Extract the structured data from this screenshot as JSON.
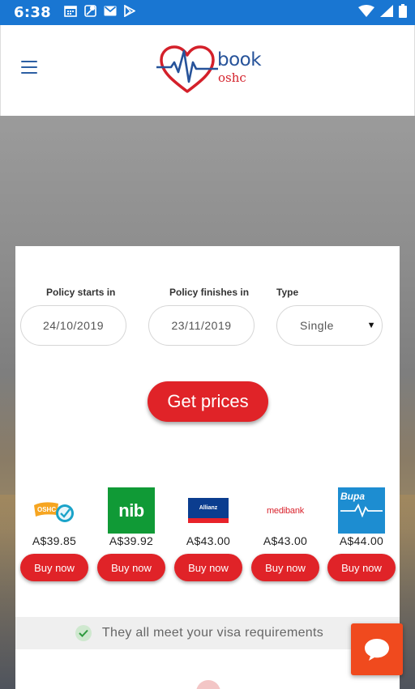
{
  "status_bar": {
    "time": "6:38",
    "left_icons": [
      "calendar-icon",
      "maps-icon",
      "gmail-icon",
      "play-store-icon"
    ],
    "right_icons": [
      "wifi-icon",
      "signal-icon",
      "battery-icon"
    ],
    "background": "#1976d2"
  },
  "header": {
    "menu_icon": "hamburger-menu-icon",
    "logo_word1": "book",
    "logo_word2": "oshc",
    "logo_icon": "heart-heartbeat-icon"
  },
  "form": {
    "start_label": "Policy starts in",
    "start_value": "24/10/2019",
    "finish_label": "Policy finishes in",
    "finish_value": "23/11/2019",
    "type_label": "Type",
    "type_value": "Single",
    "submit_label": "Get prices"
  },
  "insurers": [
    {
      "logo": "ahm-oshc-logo",
      "logo_text": "OSHC",
      "price": "A$39.85",
      "button": "Buy now"
    },
    {
      "logo": "nib-logo",
      "logo_text": "nib",
      "price": "A$39.92",
      "button": "Buy now"
    },
    {
      "logo": "allianz-logo",
      "logo_text": "Allianz",
      "price": "A$43.00",
      "button": "Buy now"
    },
    {
      "logo": "medibank-logo",
      "logo_text": "medibank",
      "price": "A$43.00",
      "button": "Buy now"
    },
    {
      "logo": "bupa-logo",
      "logo_text": "Bupa",
      "price": "A$44.00",
      "button": "Buy now"
    }
  ],
  "visa_note": "They all meet your visa requirements",
  "colors": {
    "accent_red": "#e02328",
    "brand_blue": "#27539a",
    "chat_orange": "#f04a1e"
  }
}
